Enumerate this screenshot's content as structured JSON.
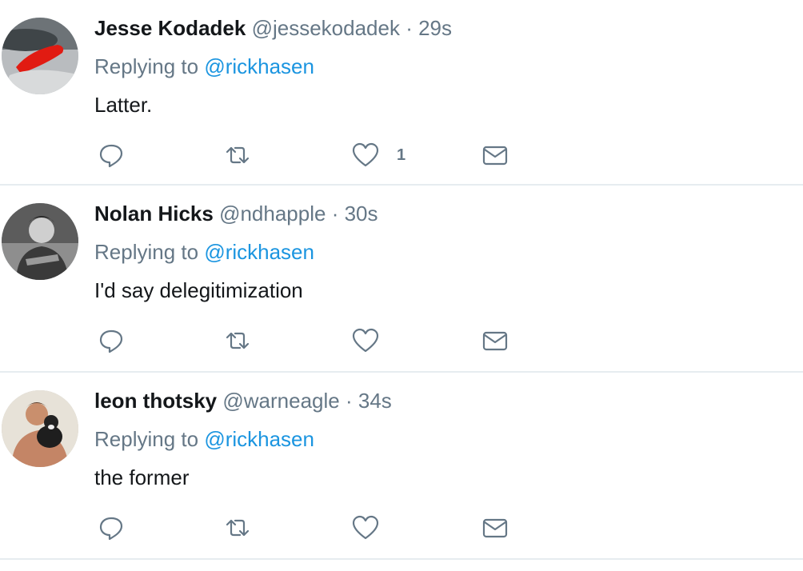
{
  "tweets": [
    {
      "name": "Jesse Kodadek",
      "handle": "@jessekodadek",
      "separator": "·",
      "time": "29s",
      "replying_prefix": "Replying to",
      "replying_to": "@rickhasen",
      "text": "Latter.",
      "like_count": "1",
      "avatar": "red-fish-photo"
    },
    {
      "name": "Nolan Hicks",
      "handle": "@ndhapple",
      "separator": "·",
      "time": "30s",
      "replying_prefix": "Replying to",
      "replying_to": "@rickhasen",
      "text": "I'd say delegitimization",
      "like_count": "",
      "avatar": "bw-man-photo"
    },
    {
      "name": "leon thotsky",
      "handle": "@warneagle",
      "separator": "·",
      "time": "34s",
      "replying_prefix": "Replying to",
      "replying_to": "@rickhasen",
      "text": "the former",
      "like_count": "",
      "avatar": "man-with-dog-photo"
    }
  ],
  "icons": {
    "reply": "reply-icon",
    "retweet": "retweet-icon",
    "like": "heart-icon",
    "message": "envelope-icon"
  },
  "colors": {
    "name": "#14171a",
    "meta": "#657786",
    "mention": "#1b95e0",
    "divider": "#e6ecf0"
  }
}
